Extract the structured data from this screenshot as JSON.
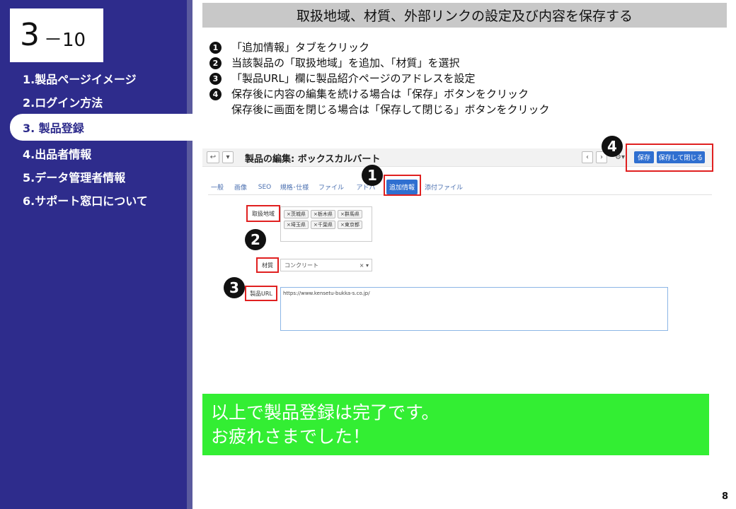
{
  "section": {
    "number": "3",
    "sub": "－10"
  },
  "nav": [
    {
      "label": "1.製品ページイメージ",
      "active": false
    },
    {
      "label": "2.ログイン方法",
      "active": false
    },
    {
      "label": "3. 製品登録",
      "active": true
    },
    {
      "label": "4.出品者情報",
      "active": false
    },
    {
      "label": "5.データ管理者情報",
      "active": false
    },
    {
      "label": "6.サポート窓口について",
      "active": false
    }
  ],
  "header": {
    "title": "取扱地域、材質、外部リンクの設定及び内容を保存する"
  },
  "steps": [
    {
      "num": "1",
      "text": "「追加情報」タブをクリック"
    },
    {
      "num": "2",
      "text": "当該製品の「取扱地域」を追加、「材質」を選択"
    },
    {
      "num": "3",
      "text": "「製品URL」欄に製品紹介ページのアドレスを設定"
    },
    {
      "num": "4",
      "text": "保存後に内容の編集を続ける場合は「保存」ボタンをクリック"
    },
    {
      "num": "",
      "text": "保存後に画面を閉じる場合は「保存して閉じる」ボタンをクリック"
    }
  ],
  "screenshot": {
    "title": "製品の編集: ボックスカルバート",
    "back_icon": "↩",
    "dropdown_icon": "▾",
    "prev_icon": "‹",
    "next_icon": "›",
    "gear_icon": "⚙▾",
    "save_label": "保存",
    "save_close_label": "保存して閉じる",
    "tabs": [
      "一般",
      "画像",
      "SEO",
      "規格･仕様",
      "ファイル",
      "アドバ",
      "追加情報",
      "添付ファイル"
    ],
    "active_tab": "追加情報",
    "region_label": "取扱地域",
    "regions": [
      "×茨城県",
      "×栃木県",
      "×群馬県",
      "×埼玉県",
      "×千葉県",
      "×東京都"
    ],
    "material_label": "材質",
    "material_value": "コンクリート",
    "material_controls": "× ▾",
    "url_label": "製品URL",
    "url_value": "https://www.kensetu-bukka-s.co.jp/"
  },
  "markers": [
    "1",
    "2",
    "3",
    "4"
  ],
  "banner": {
    "line1": "以上で製品登録は完了です。",
    "line2": "お疲れさまでした！"
  },
  "page_number": "8",
  "colors": {
    "sidebar": "#2e2c8c",
    "banner": "#33ee33",
    "header": "#c8c8c8",
    "highlight": "#e02020",
    "button": "#2f6fd0"
  }
}
